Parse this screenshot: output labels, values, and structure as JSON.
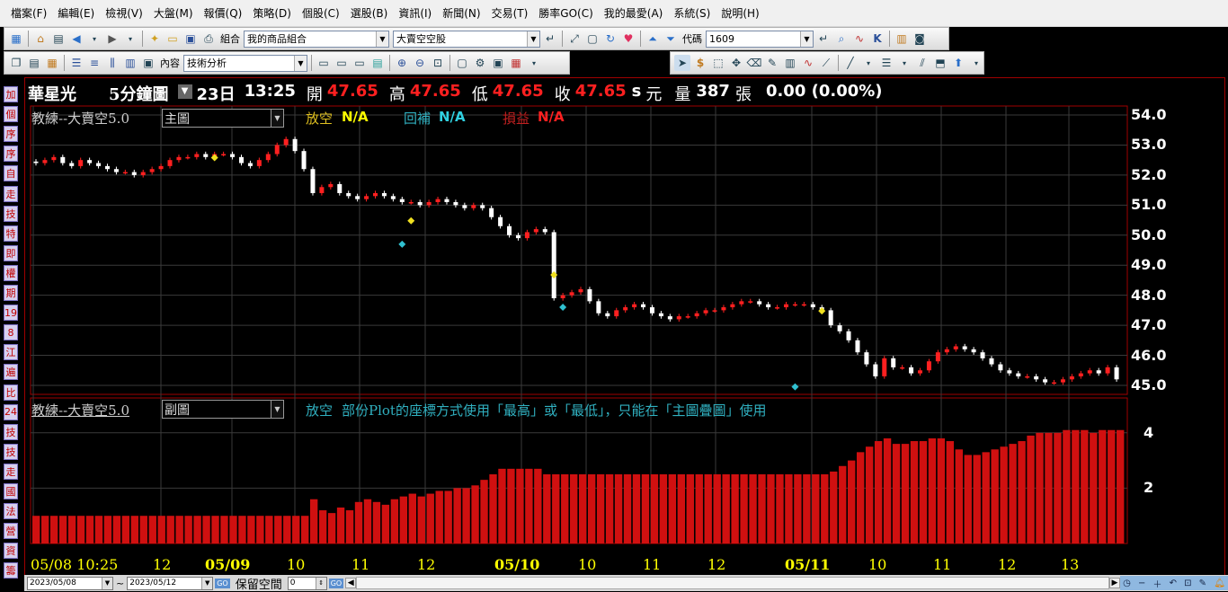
{
  "menu": [
    "檔案(F)",
    "編輯(E)",
    "檢視(V)",
    "大盤(M)",
    "報價(Q)",
    "策略(D)",
    "個股(C)",
    "選股(B)",
    "資訊(I)",
    "新聞(N)",
    "交易(T)",
    "勝率GO(C)",
    "我的最愛(A)",
    "系統(S)",
    "說明(H)"
  ],
  "toolbar1": {
    "portfolio_label": "組合",
    "portfolio_value": "我的商品組合",
    "strategy_value": "大賣空空股",
    "code_label": "代碼",
    "code_value": "1609"
  },
  "toolbar2": {
    "content_label": "內容",
    "content_value": "技術分析"
  },
  "sidebar": [
    "加",
    "個",
    "序",
    "序",
    "自",
    "走",
    "技",
    "特",
    "即",
    "權",
    "期",
    "19",
    "8",
    "江",
    "遍",
    "比",
    "24",
    "技",
    "技",
    "走",
    "國",
    "法",
    "營",
    "資",
    "籌"
  ],
  "quote": {
    "name": "華星光",
    "period": "5分鐘圖",
    "day": "23日",
    "time": "13:25",
    "open_label": "開",
    "open": "47.65",
    "high_label": "高",
    "high": "47.65",
    "low_label": "低",
    "low": "47.65",
    "close_label": "收",
    "close": "47.65",
    "close_flag": "s",
    "currency": "元",
    "volume_label": "量",
    "volume": "387",
    "volume_unit": "張",
    "change": "0.00 (0.00%)"
  },
  "main_panel": {
    "indicator": "教練--大賣空5.0",
    "chart_select": "主圖",
    "short_label": "放空",
    "short_value": "N/A",
    "cover_label": "回補",
    "cover_value": "N/A",
    "pnl_label": "損益",
    "pnl_value": "N/A"
  },
  "sub_panel": {
    "indicator": "教練--大賣空5.0",
    "chart_select": "副圖",
    "short_label": "放空",
    "message": "部份Plot的座標方式使用「最高」或「最低」，只能在「主圖疊圖」使用"
  },
  "bottom": {
    "start_date": "2023/05/08",
    "tilde": "~",
    "end_date": "2023/05/12",
    "keep_space_label": "保留空間",
    "keep_space_value": "0"
  },
  "colors": {
    "up": "#ff2020",
    "down": "#ffffff",
    "grid": "#3a3a3a",
    "axis": "#a00000",
    "histogram": "#d01010",
    "short_signal": "#f0e020",
    "cover_signal": "#30c0d0"
  },
  "chart_data": [
    {
      "type": "candlestick",
      "title": "",
      "ylim": [
        44.7,
        54.3
      ],
      "y_ticks": [
        "54.0",
        "53.0",
        "52.0",
        "51.0",
        "50.0",
        "49.0",
        "48.0",
        "47.0",
        "46.0",
        "45.0"
      ],
      "x_ticks": [
        {
          "label": "05/08 10:25",
          "bold": false
        },
        {
          "label": "12",
          "bold": false
        },
        {
          "label": "05/09",
          "bold": true
        },
        {
          "label": "10",
          "bold": false
        },
        {
          "label": "11",
          "bold": false
        },
        {
          "label": "12",
          "bold": false
        },
        {
          "label": "05/10",
          "bold": true
        },
        {
          "label": "10",
          "bold": false
        },
        {
          "label": "11",
          "bold": false
        },
        {
          "label": "12",
          "bold": false
        },
        {
          "label": "05/11",
          "bold": true
        },
        {
          "label": "10",
          "bold": false
        },
        {
          "label": "11",
          "bold": false
        },
        {
          "label": "12",
          "bold": false
        },
        {
          "label": "13",
          "bold": false
        }
      ],
      "close": [
        52.4,
        52.5,
        52.6,
        52.4,
        52.3,
        52.5,
        52.4,
        52.3,
        52.2,
        52.1,
        52.1,
        52.0,
        52.1,
        52.2,
        52.3,
        52.5,
        52.6,
        52.6,
        52.7,
        52.6,
        52.7,
        52.7,
        52.6,
        52.4,
        52.3,
        52.5,
        52.7,
        53.0,
        53.2,
        52.8,
        52.2,
        51.4,
        51.6,
        51.7,
        51.4,
        51.3,
        51.2,
        51.3,
        51.4,
        51.3,
        51.2,
        51.1,
        51.1,
        51.0,
        51.1,
        51.2,
        51.1,
        51.0,
        50.9,
        51.0,
        50.9,
        50.6,
        50.3,
        50.0,
        49.9,
        50.1,
        50.2,
        50.1,
        47.9,
        48.0,
        48.1,
        48.2,
        47.8,
        47.4,
        47.3,
        47.5,
        47.6,
        47.7,
        47.6,
        47.4,
        47.3,
        47.2,
        47.3,
        47.3,
        47.4,
        47.5,
        47.5,
        47.6,
        47.7,
        47.8,
        47.8,
        47.7,
        47.6,
        47.6,
        47.7,
        47.7,
        47.7,
        47.6,
        47.5,
        47.0,
        46.8,
        46.5,
        46.1,
        45.7,
        45.3,
        45.9,
        45.6,
        45.6,
        45.4,
        45.5,
        45.8,
        46.1,
        46.2,
        46.3,
        46.2,
        46.1,
        45.9,
        45.7,
        45.5,
        45.4,
        45.3,
        45.3,
        45.2,
        45.1,
        45.1,
        45.2,
        45.3,
        45.4,
        45.5,
        45.4,
        45.6,
        45.2
      ],
      "short_signals": [
        [
          20,
          52.4
        ],
        [
          42,
          50.3
        ],
        [
          58,
          48.5
        ],
        [
          88,
          47.3
        ]
      ],
      "cover_signals": [
        [
          41,
          49.7
        ],
        [
          59,
          47.6
        ],
        [
          85,
          44.95
        ]
      ]
    },
    {
      "type": "bar",
      "title": "",
      "ylim": [
        0,
        5
      ],
      "y_ticks": [
        "4",
        "2"
      ],
      "values": [
        1,
        1,
        1,
        1,
        1,
        1,
        1,
        1,
        1,
        1,
        1,
        1,
        1,
        1,
        1,
        1,
        1,
        1,
        1,
        1,
        1,
        1,
        1,
        1,
        1,
        1,
        1,
        1,
        1,
        1,
        1,
        1.6,
        1.2,
        1.1,
        1.3,
        1.2,
        1.5,
        1.6,
        1.5,
        1.4,
        1.6,
        1.7,
        1.8,
        1.7,
        1.8,
        1.9,
        1.9,
        2,
        2,
        2.1,
        2.3,
        2.5,
        2.7,
        2.7,
        2.7,
        2.7,
        2.7,
        2.5,
        2.5,
        2.5,
        2.5,
        2.5,
        2.5,
        2.5,
        2.5,
        2.5,
        2.5,
        2.5,
        2.5,
        2.5,
        2.5,
        2.5,
        2.5,
        2.5,
        2.5,
        2.5,
        2.5,
        2.5,
        2.5,
        2.5,
        2.5,
        2.5,
        2.5,
        2.5,
        2.5,
        2.5,
        2.5,
        2.5,
        2.5,
        2.6,
        2.8,
        3.0,
        3.3,
        3.5,
        3.7,
        3.8,
        3.6,
        3.6,
        3.7,
        3.7,
        3.8,
        3.8,
        3.7,
        3.4,
        3.2,
        3.2,
        3.3,
        3.4,
        3.5,
        3.6,
        3.7,
        3.9,
        4.0,
        4.0,
        4.0,
        4.1,
        4.1,
        4.1,
        4.0,
        4.1,
        4.1,
        4.1
      ]
    }
  ]
}
